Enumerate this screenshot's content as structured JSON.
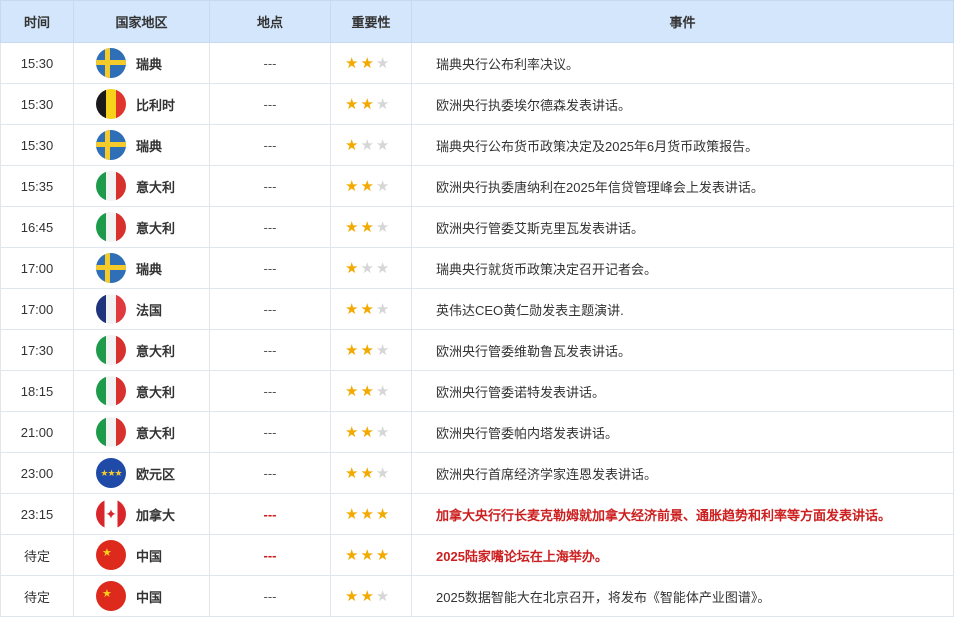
{
  "headers": {
    "time": "时间",
    "country": "国家地区",
    "location": "地点",
    "importance": "重要性",
    "event": "事件"
  },
  "rows": [
    {
      "time": "15:30",
      "flag": "sweden-flag",
      "country": "瑞典",
      "location": "---",
      "importance": 2,
      "event": "瑞典央行公布利率决议。",
      "highlight": false
    },
    {
      "time": "15:30",
      "flag": "belgium-flag",
      "country": "比利时",
      "location": "---",
      "importance": 2,
      "event": "欧洲央行执委埃尔德森发表讲话。",
      "highlight": false
    },
    {
      "time": "15:30",
      "flag": "sweden-flag",
      "country": "瑞典",
      "location": "---",
      "importance": 1,
      "event": "瑞典央行公布货币政策决定及2025年6月货币政策报告。",
      "highlight": false
    },
    {
      "time": "15:35",
      "flag": "italy-flag",
      "country": "意大利",
      "location": "---",
      "importance": 2,
      "event": "欧洲央行执委唐纳利在2025年信贷管理峰会上发表讲话。",
      "highlight": false
    },
    {
      "time": "16:45",
      "flag": "italy-flag",
      "country": "意大利",
      "location": "---",
      "importance": 2,
      "event": "欧洲央行管委艾斯克里瓦发表讲话。",
      "highlight": false
    },
    {
      "time": "17:00",
      "flag": "sweden-flag",
      "country": "瑞典",
      "location": "---",
      "importance": 1,
      "event": "瑞典央行就货币政策决定召开记者会。",
      "highlight": false
    },
    {
      "time": "17:00",
      "flag": "france-flag",
      "country": "法国",
      "location": "---",
      "importance": 2,
      "event": "英伟达CEO黄仁勋发表主题演讲.",
      "highlight": false
    },
    {
      "time": "17:30",
      "flag": "italy-flag",
      "country": "意大利",
      "location": "---",
      "importance": 2,
      "event": "欧洲央行管委维勒鲁瓦发表讲话。",
      "highlight": false
    },
    {
      "time": "18:15",
      "flag": "italy-flag",
      "country": "意大利",
      "location": "---",
      "importance": 2,
      "event": "欧洲央行管委诺特发表讲话。",
      "highlight": false
    },
    {
      "time": "21:00",
      "flag": "italy-flag",
      "country": "意大利",
      "location": "---",
      "importance": 2,
      "event": "欧洲央行管委帕内塔发表讲话。",
      "highlight": false
    },
    {
      "time": "23:00",
      "flag": "eu-flag",
      "country": "欧元区",
      "location": "---",
      "importance": 2,
      "event": "欧洲央行首席经济学家连恩发表讲话。",
      "highlight": false
    },
    {
      "time": "23:15",
      "flag": "canada-flag",
      "country": "加拿大",
      "location": "---",
      "importance": 3,
      "event": "加拿大央行行长麦克勒姆就加拿大经济前景、通胀趋势和利率等方面发表讲话。",
      "highlight": true
    },
    {
      "time": "待定",
      "flag": "china-flag",
      "country": "中国",
      "location": "---",
      "importance": 3,
      "event": "2025陆家嘴论坛在上海举办。",
      "highlight": true
    },
    {
      "time": "待定",
      "flag": "china-flag",
      "country": "中国",
      "location": "---",
      "importance": 2,
      "event": "2025数据智能大在北京召开，将发布《智能体产业图谱》。",
      "highlight": false
    }
  ],
  "max_importance": 3,
  "colors": {
    "header_bg": "#d4e6fb",
    "highlight": "#cc1e1e",
    "star_on": "#f2a900",
    "star_off": "#d6d6d6"
  }
}
